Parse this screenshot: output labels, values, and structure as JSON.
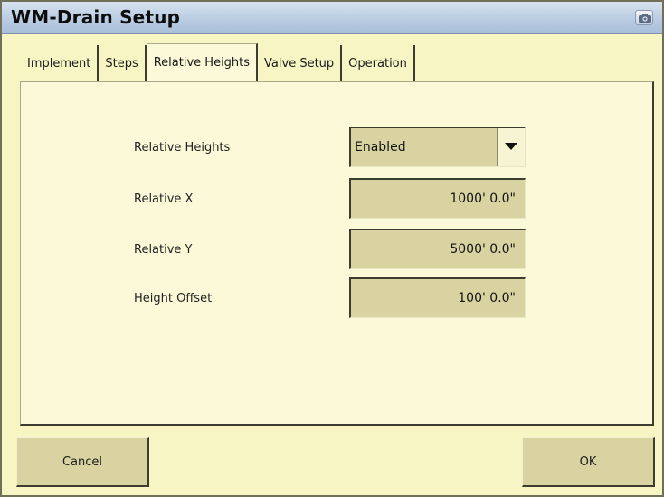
{
  "window": {
    "title": "WM-Drain Setup",
    "camera_icon": "camera-icon"
  },
  "tabs": [
    {
      "label": "Implement",
      "active": false
    },
    {
      "label": "Steps",
      "active": false
    },
    {
      "label": "Relative Heights",
      "active": true
    },
    {
      "label": "Valve Setup",
      "active": false
    },
    {
      "label": "Operation",
      "active": false
    }
  ],
  "form": {
    "relative_heights": {
      "label": "Relative Heights",
      "value": "Enabled",
      "icon": "dropdown-arrow-icon"
    },
    "relative_x": {
      "label": "Relative X",
      "value": "1000' 0.0\""
    },
    "relative_y": {
      "label": "Relative Y",
      "value": "5000' 0.0\""
    },
    "height_offset": {
      "label": "Height Offset",
      "value": "100' 0.0\""
    }
  },
  "buttons": {
    "cancel": "Cancel",
    "ok": "OK"
  },
  "colors": {
    "background": "#f7f5c4",
    "panel": "#fbf9d8",
    "field": "#d8d3a1",
    "titlebar": "#b9cce2"
  }
}
